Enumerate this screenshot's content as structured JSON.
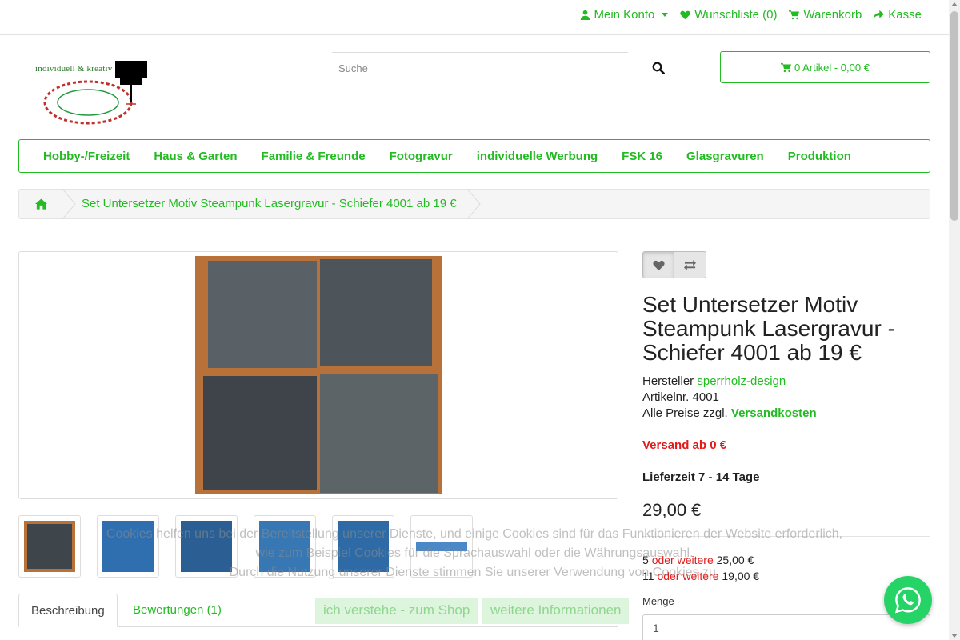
{
  "colors": {
    "accent": "#22bb22",
    "red": "#e21a1a",
    "whatsapp": "#25d366"
  },
  "topnav": {
    "account": "Mein Konto",
    "wishlist": "Wunschliste (0)",
    "cart": "Warenkorb",
    "checkout": "Kasse"
  },
  "logo": {
    "tagline": "individuell & kreativ"
  },
  "search": {
    "placeholder": "Suche"
  },
  "cart_button": "0 Artikel - 0,00 €",
  "categories": [
    "Hobby-/Freizeit",
    "Haus & Garten",
    "Familie & Freunde",
    "Fotogravur",
    "individuelle Werbung",
    "FSK 16",
    "Glasgravuren",
    "Produktion"
  ],
  "breadcrumb": {
    "current": "Set Untersetzer Motiv Steampunk Lasergravur - Schiefer 4001 ab 19 €"
  },
  "tabs": {
    "description": "Beschreibung",
    "reviews": "Bewertungen (1)"
  },
  "product": {
    "title": "Set Untersetzer Motiv Steampunk Lasergravur - Schiefer 4001 ab 19 €",
    "manufacturer_label": "Hersteller",
    "manufacturer": "sperrholz-design",
    "sku_label": "Artikelnr. 4001",
    "prices_label": "Alle Preise zzgl.",
    "shipping_link": "Versandkosten",
    "shipping_from": "Versand ab 0 €",
    "delivery": "Lieferzeit 7 - 14 Tage",
    "price": "29,00 €",
    "tiers": [
      {
        "qty": "5",
        "label": "oder weitere",
        "price": "25,00 €"
      },
      {
        "qty": "11",
        "label": "oder weitere",
        "price": "19,00 €"
      }
    ],
    "quantity_label": "Menge",
    "quantity": "1"
  },
  "cookie": {
    "line1": "Cookies helfen uns bei der Bereitstellung unserer Dienste, und einige Cookies sind für das Funktionieren der Website erforderlich,",
    "line2": "wie zum Beispiel Cookies für die Sprachauswahl oder die Währungsauswahl.",
    "line3": "Durch die Nutzung unserer Dienste stimmen Sie unserer Verwendung von Cookies zu.",
    "accept": "ich verstehe - zum Shop",
    "more": "weitere Informationen"
  }
}
